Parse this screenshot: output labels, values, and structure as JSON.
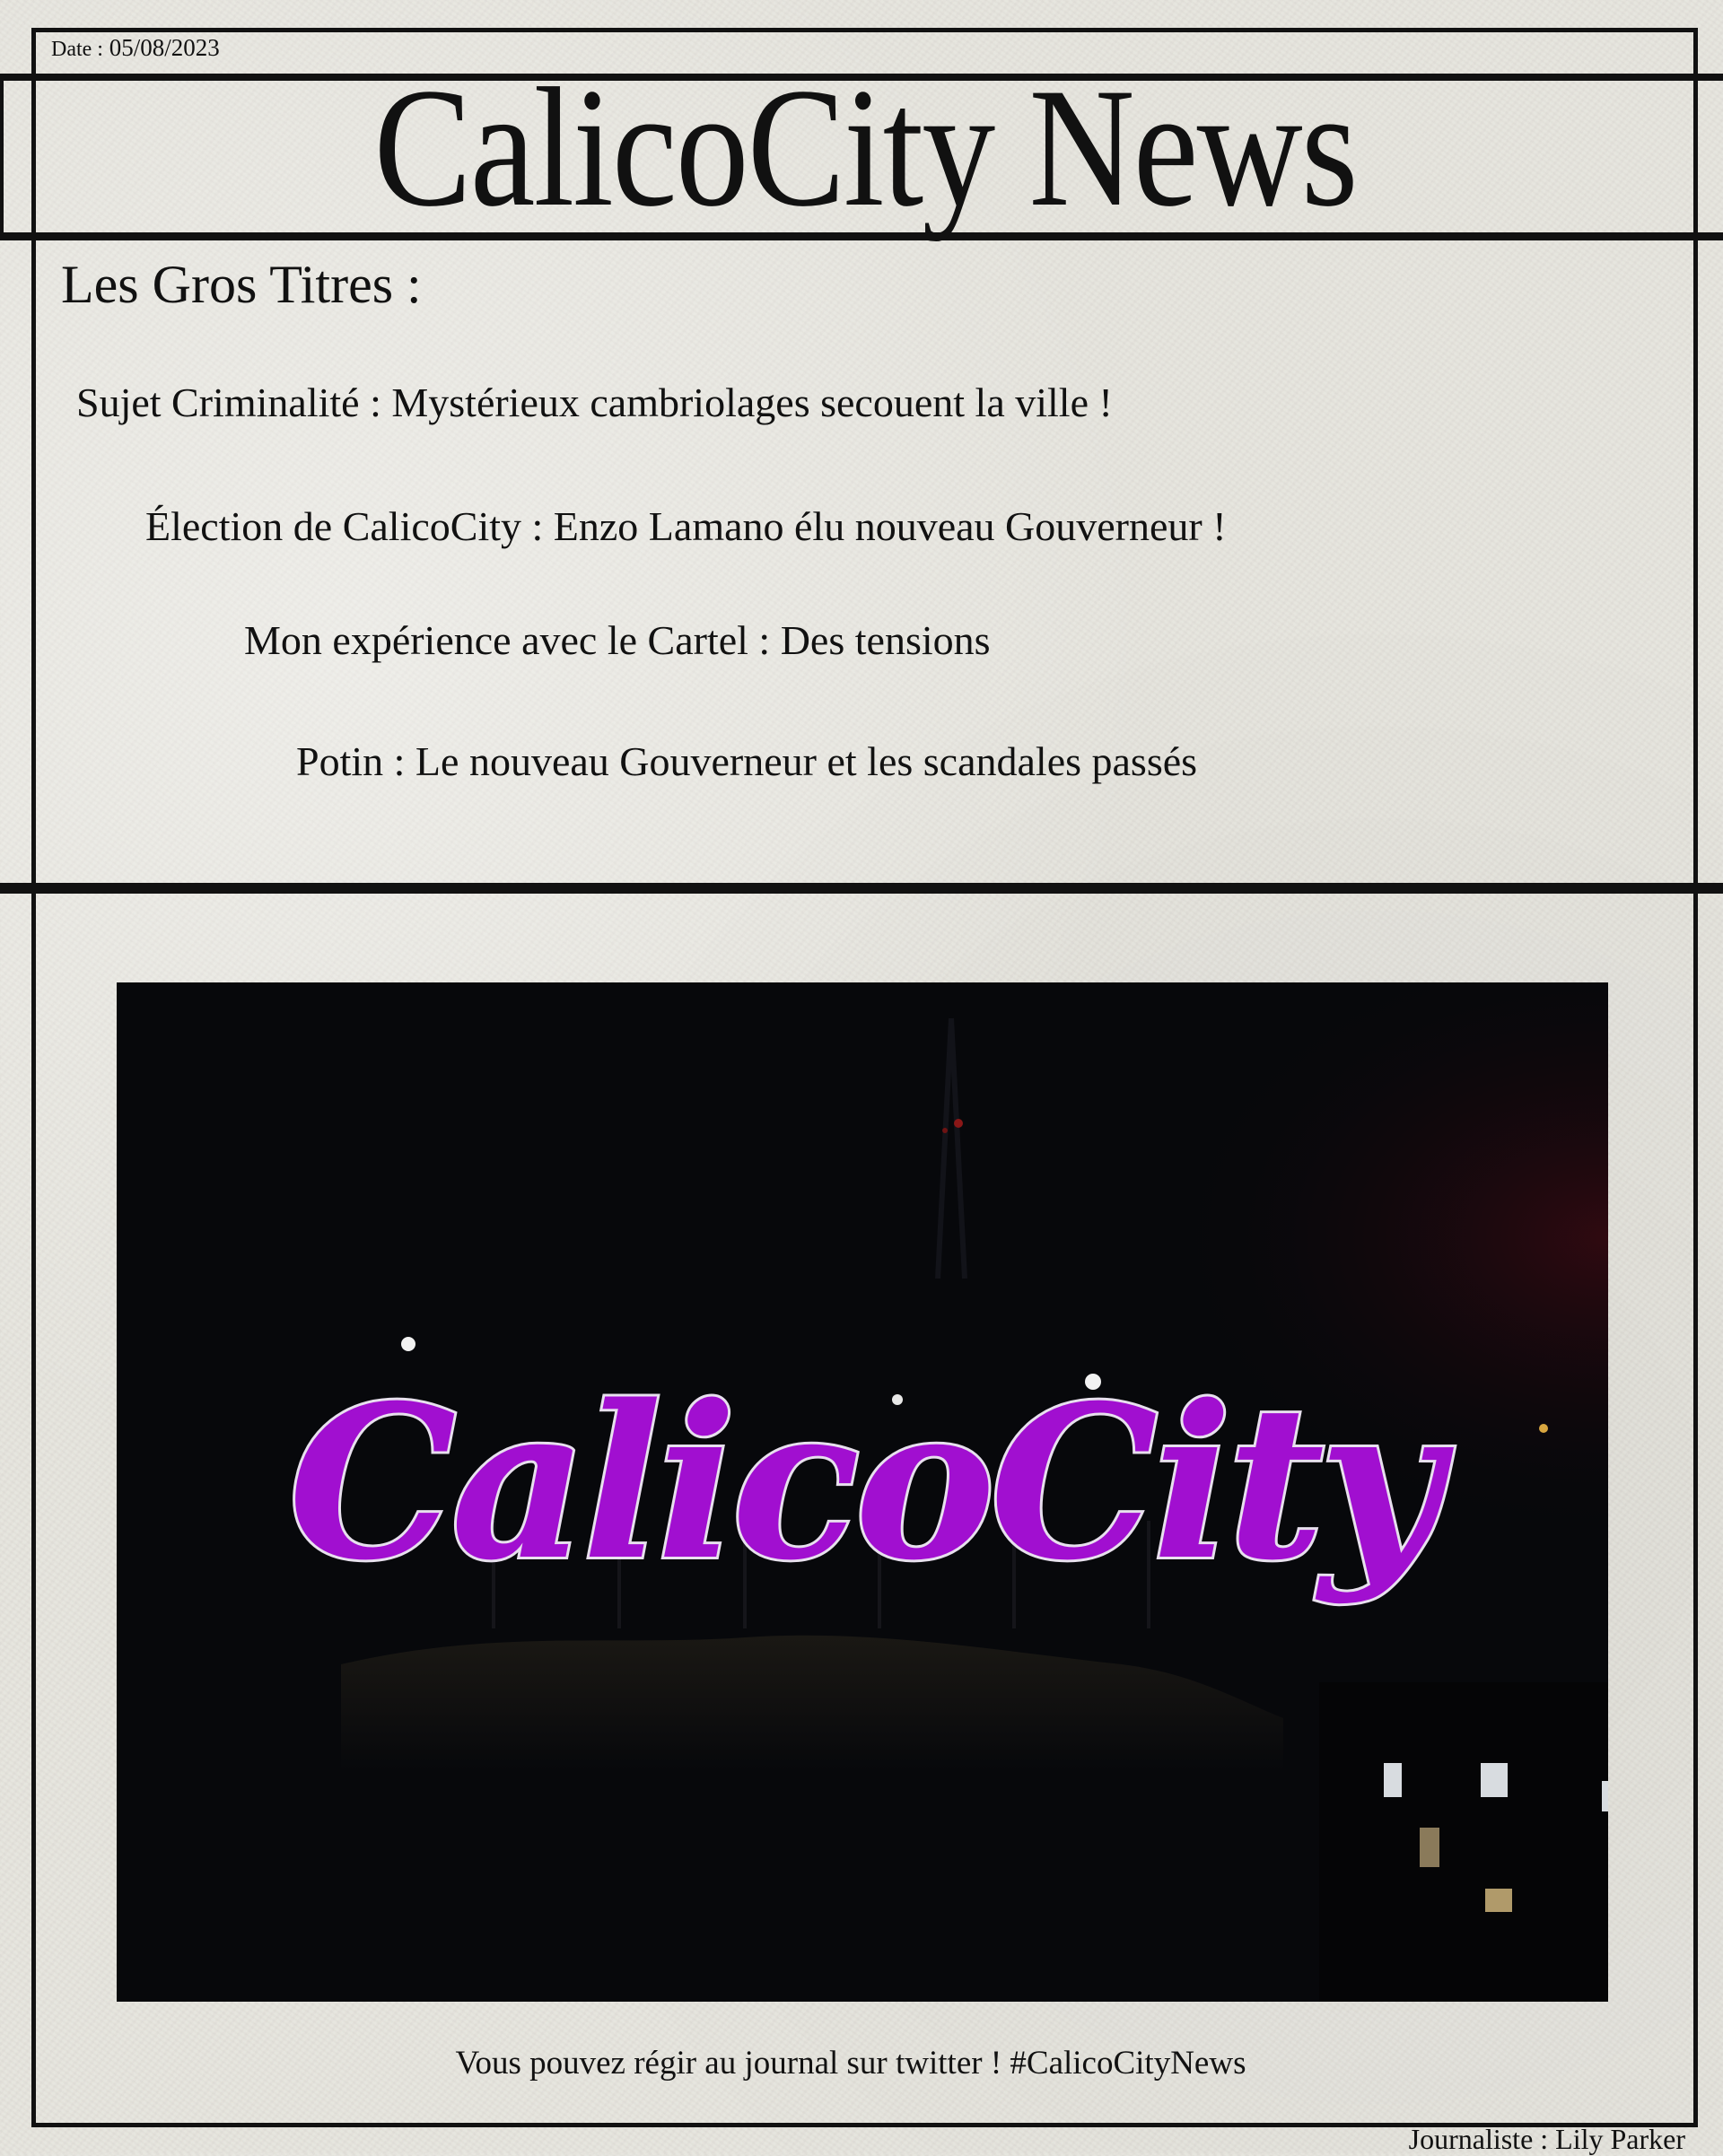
{
  "header": {
    "date_label": "Date :",
    "date_value": "05/08/2023",
    "title": "CalicoCity News"
  },
  "headlines_section": {
    "title": "Les Gros Titres :",
    "items": [
      "Sujet Criminalité : Mystérieux cambriolages secouent la ville !",
      "Élection de CalicoCity : Enzo Lamano élu nouveau Gouverneur !",
      "Mon expérience avec le Cartel : Des tensions",
      "Potin : Le nouveau Gouverneur et les scandales passés"
    ]
  },
  "photo": {
    "sign_text": "CalicoCity",
    "sign_color": "#a10fd0",
    "sign_outline": "#e8e0ee"
  },
  "footer": {
    "note": "Vous pouvez régir au journal sur twitter ! #CalicoCityNews",
    "journalist": "Journaliste : Lily Parker"
  }
}
